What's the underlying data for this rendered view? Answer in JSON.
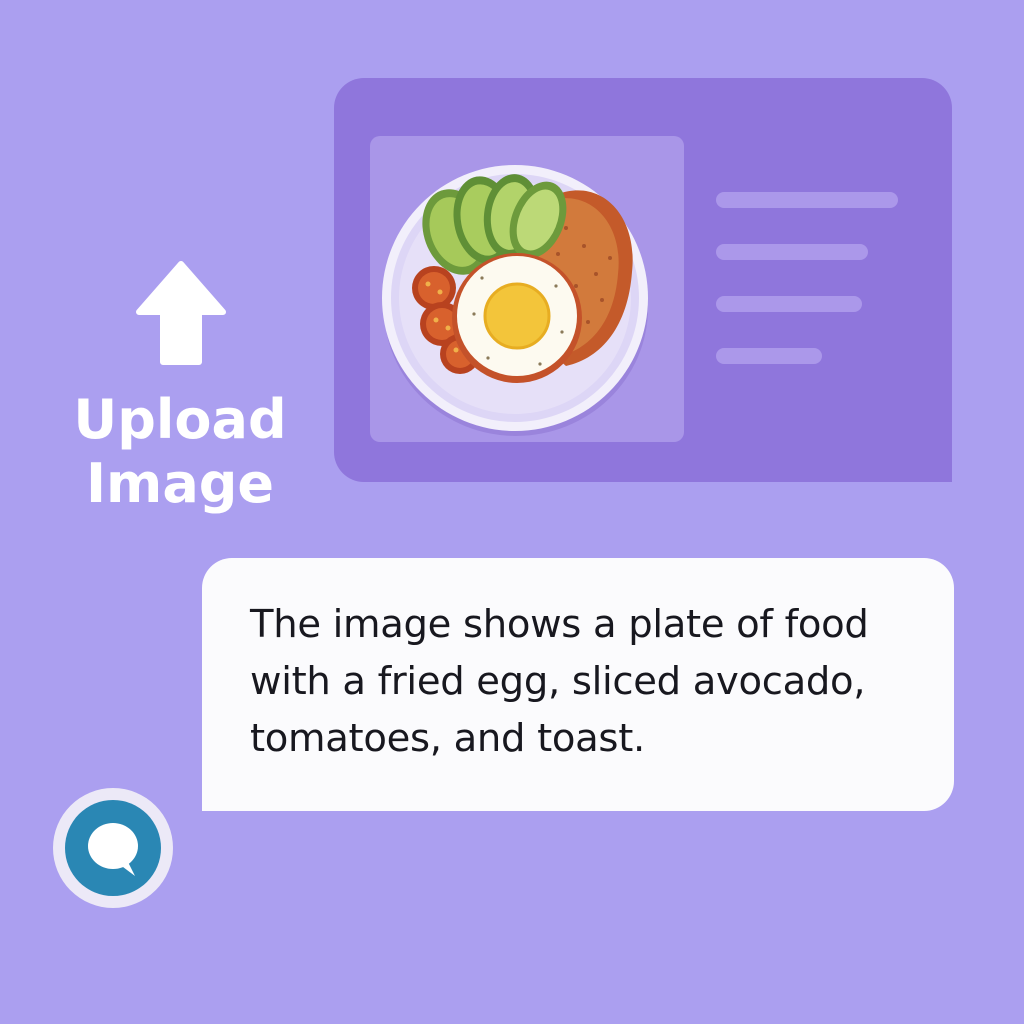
{
  "upload": {
    "line1": "Upload",
    "line2": "Image",
    "icon": "upload-arrow-icon"
  },
  "preview": {
    "thumbnail": "food-plate-thumbnail",
    "text_placeholder_lines": 4
  },
  "caption": {
    "text": "The image shows a plate of food with a fried egg, sliced avocado, tomatoes, and toast."
  },
  "assistant": {
    "icon": "chat-bubble-icon"
  },
  "colors": {
    "background": "#ab9ff0",
    "card": "#8f76dc",
    "bubble": "#fbfbfd",
    "avatar_ring": "#2a87b4"
  }
}
